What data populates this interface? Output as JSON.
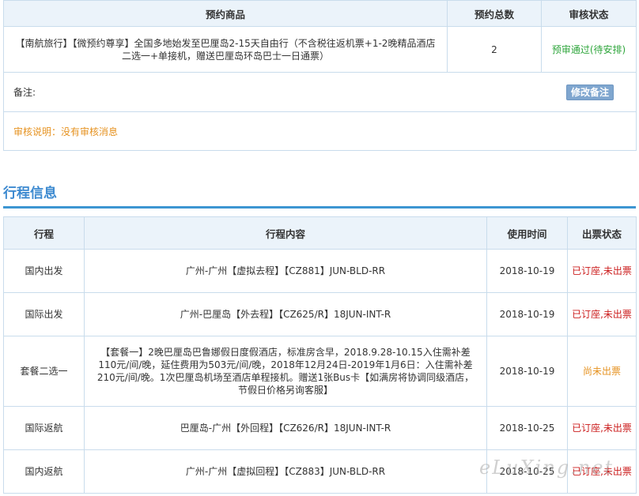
{
  "booking": {
    "headers": {
      "product": "预约商品",
      "count": "预约总数",
      "status": "审核状态"
    },
    "product": "【南航旅行】【微预约尊享】全国多地始发至巴厘岛2-15天自由行（不含税往返机票+1-2晚精品酒店二选一+单接机，赠送巴厘岛环岛巴士一日通票）",
    "count": "2",
    "status": "预审通过(待安排)",
    "remark_label": "备注:",
    "edit_button": "修改备注",
    "audit_note": "审核说明：没有审核消息"
  },
  "itinerary": {
    "title": "行程信息",
    "headers": {
      "trip": "行程",
      "content": "行程内容",
      "date": "使用时间",
      "ticket": "出票状态"
    },
    "rows": [
      {
        "trip": "国内出发",
        "content": "广州-广州【虚拟去程】【CZ881】JUN-BLD-RR",
        "date": "2018-10-19",
        "ticket": "已订座,未出票"
      },
      {
        "trip": "国际出发",
        "content": "广州-巴厘岛【外去程】【CZ625/R】18JUN-INT-R",
        "date": "2018-10-19",
        "ticket": "已订座,未出票"
      },
      {
        "trip": "套餐二选一",
        "content": "【套餐一】2晚巴厘岛巴鲁娜假日度假酒店，标准房含早，2018.9.28-10.15入住需补差110元/间/晚，延住费用为503元/间/晚，2018年12月24日-2019年1月6日：入住需补差210元/间/晚。1次巴厘岛机场至酒店单程接机。赠送1张Bus卡【如满房将协调同级酒店，节假日价格另询客服】",
        "date": "2018-10-19",
        "ticket": "尚未出票"
      },
      {
        "trip": "国际返航",
        "content": "巴厘岛-广州【外回程】【CZ626/R】18JUN-INT-R",
        "date": "2018-10-25",
        "ticket": "已订座,未出票"
      },
      {
        "trip": "国内返航",
        "content": "广州-广州【虚拟回程】【CZ883】JUN-BLD-RR",
        "date": "2018-10-25",
        "ticket": "已订座,未出票"
      }
    ]
  },
  "watermark": "eLuXing.net",
  "colors": {
    "accent": "#3d8ad0",
    "approved": "#2fa63c",
    "warning": "#e69322",
    "danger": "#cc1f1f",
    "header_bg": "#ebf3fa",
    "border": "#c9dcec"
  }
}
